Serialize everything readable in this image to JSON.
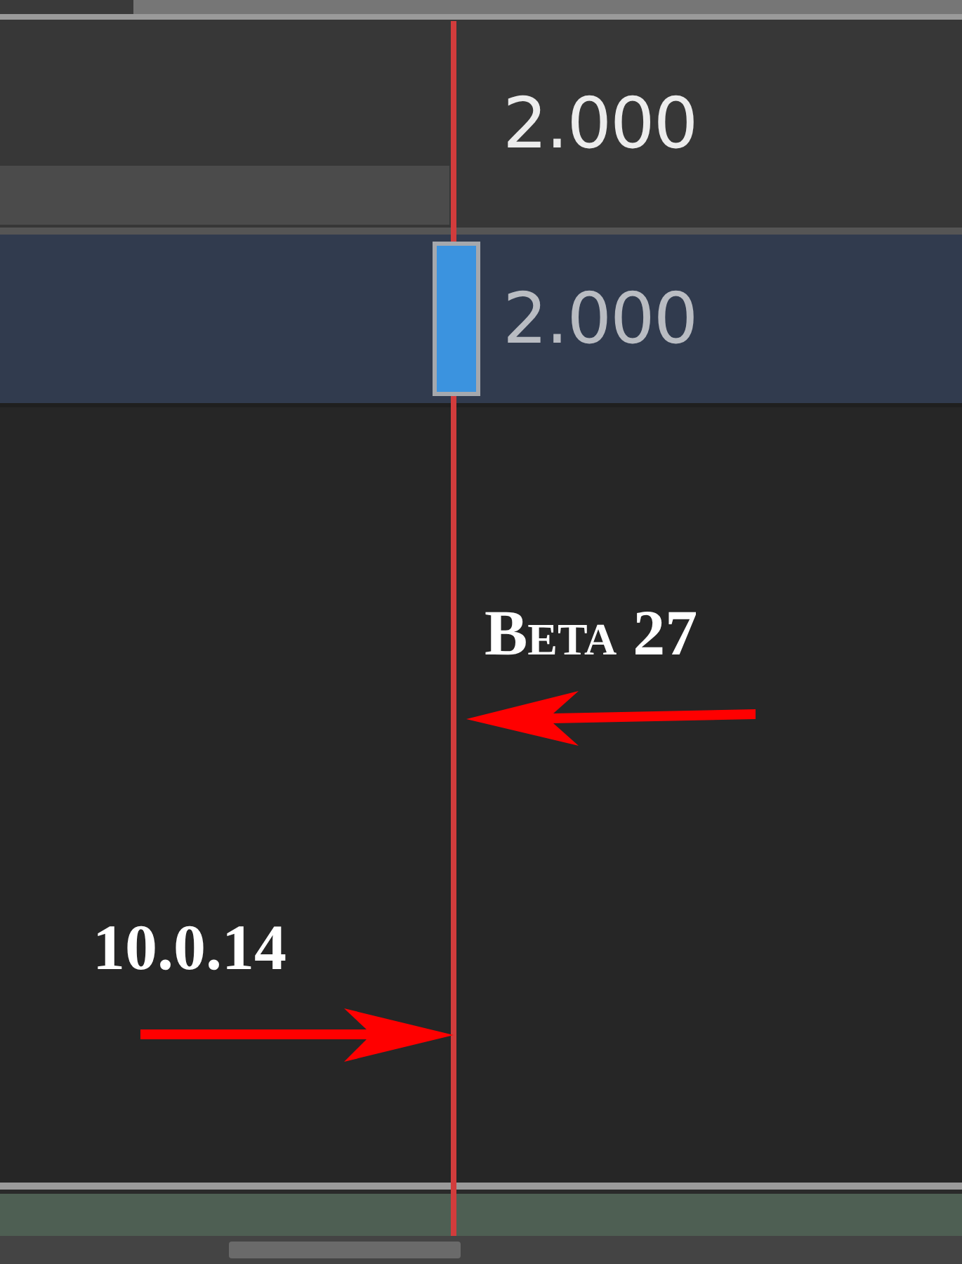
{
  "tracks": [
    {
      "value": "2.000",
      "selected": false,
      "keyframe": false
    },
    {
      "value": "2.000",
      "selected": true,
      "keyframe": true
    }
  ],
  "annotations": [
    {
      "text": "Beta 27",
      "kind": "left"
    },
    {
      "text": "10.0.14",
      "kind": "right"
    }
  ]
}
